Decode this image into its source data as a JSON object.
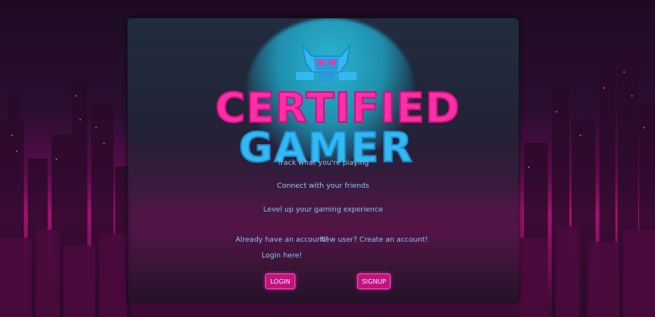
{
  "logo": {
    "line1": "CERTIFIED",
    "line2": "GAMER"
  },
  "taglines": [
    "Track what you're playing",
    "Connect with your friends",
    "Level up your gaming experience"
  ],
  "login": {
    "prompt": "Already have an account? Login here!",
    "button": "LOGIN"
  },
  "signup": {
    "prompt": "New user? Create an account!",
    "button": "SIGNUP"
  },
  "colors": {
    "accent_pink": "#ff2fa6",
    "accent_blue": "#34b8f2",
    "text": "#8bc4f0"
  }
}
